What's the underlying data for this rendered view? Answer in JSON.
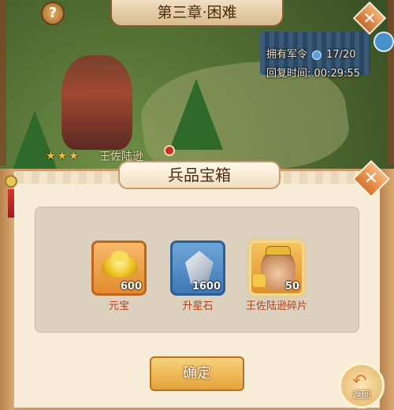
{
  "header": {
    "chapter_title": "第三章·困难",
    "help_icon": "?",
    "close_icon": "✕"
  },
  "status": {
    "tokens_label": "拥有军令",
    "tokens_value": "17/20",
    "recover_label": "回复时间:",
    "recover_value": "00:29:55"
  },
  "scene": {
    "hero_name": "王佐陆逊"
  },
  "modal": {
    "title": "兵品宝箱",
    "close_icon": "✕",
    "items": [
      {
        "name": "元宝",
        "qty": "600",
        "icon": "gold-ingot-icon"
      },
      {
        "name": "升星石",
        "qty": "1600",
        "icon": "star-stone-icon"
      },
      {
        "name": "王佐陆逊碎片",
        "qty": "50",
        "icon": "hero-shard-icon"
      }
    ],
    "confirm_label": "确定"
  },
  "back_button": {
    "label": "返回",
    "icon": "↶"
  },
  "colors": {
    "title_text": "#4a2a12",
    "item_label": "#b14418",
    "confirm_bg": "#e4a23a",
    "modal_bg": "#f7ecd8"
  }
}
